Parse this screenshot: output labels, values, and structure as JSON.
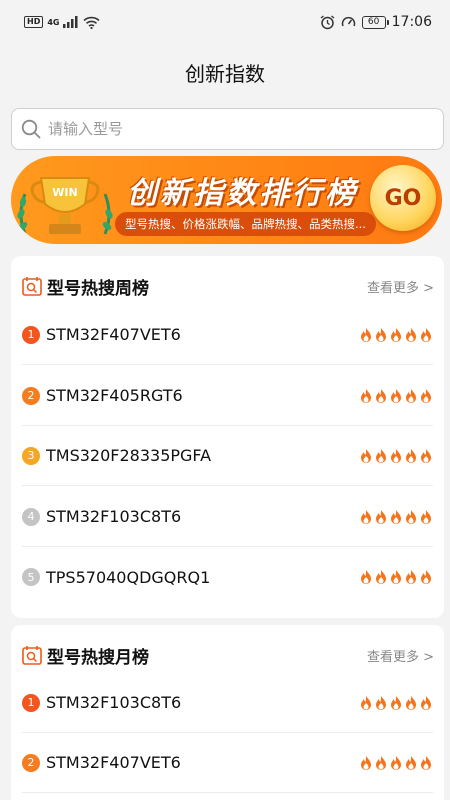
{
  "status_bar": {
    "left_badges": [
      "HD",
      "4G"
    ],
    "time": "17:06",
    "battery": "60"
  },
  "header": {
    "title": "创新指数"
  },
  "search": {
    "placeholder": "请输入型号"
  },
  "banner": {
    "title": "创新指数排行榜",
    "subtitle": "型号热搜、价格涨跌幅、品牌热搜、品类热搜...",
    "go_label": "GO",
    "trophy_label": "WIN"
  },
  "colors": {
    "accent": "#ff8a16",
    "rank1": "#f2561d",
    "rank2": "#f57c1f",
    "rank3": "#f5a623",
    "rank_other": "#c4c4c4",
    "flame": "#f5731a"
  },
  "weekly": {
    "title": "型号热搜周榜",
    "more": "查看更多 >",
    "items": [
      {
        "rank": "1",
        "name": "STM32F407VET6",
        "heat": 5
      },
      {
        "rank": "2",
        "name": "STM32F405RGT6",
        "heat": 5
      },
      {
        "rank": "3",
        "name": "TMS320F28335PGFA",
        "heat": 5
      },
      {
        "rank": "4",
        "name": "STM32F103C8T6",
        "heat": 5
      },
      {
        "rank": "5",
        "name": "TPS57040QDGQRQ1",
        "heat": 5
      }
    ]
  },
  "monthly": {
    "title": "型号热搜月榜",
    "more": "查看更多 >",
    "items": [
      {
        "rank": "1",
        "name": "STM32F103C8T6",
        "heat": 5
      },
      {
        "rank": "2",
        "name": "STM32F407VET6",
        "heat": 5
      }
    ]
  }
}
